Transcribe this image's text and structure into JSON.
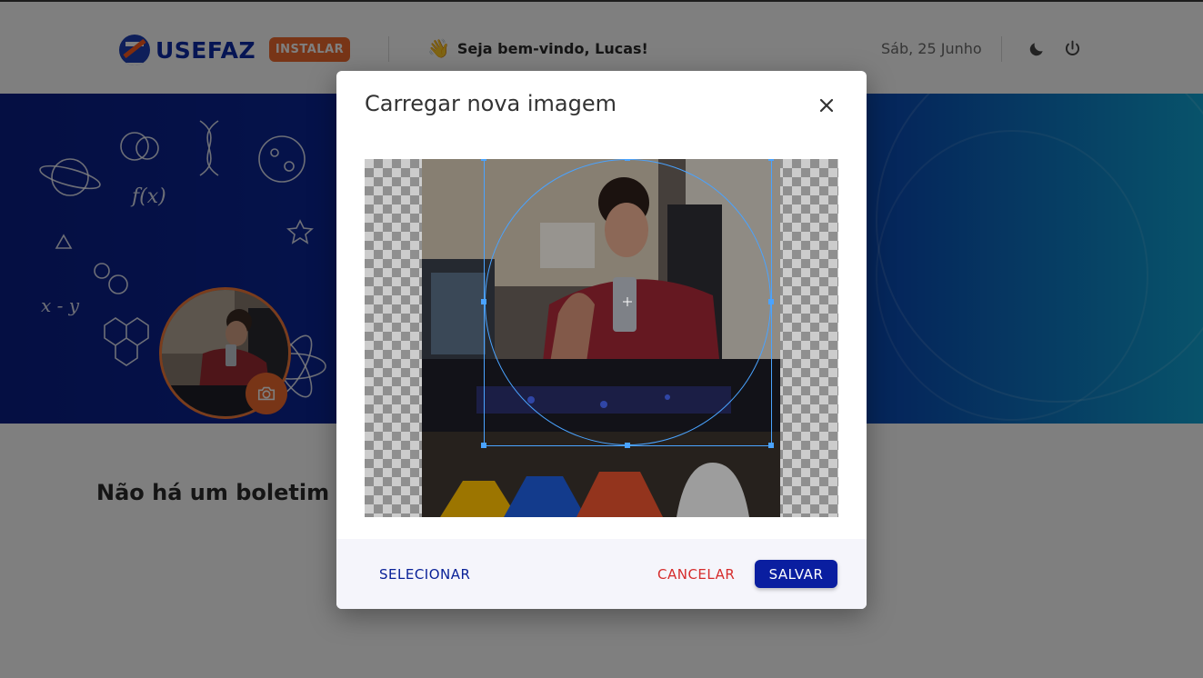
{
  "header": {
    "brand": "USEFAZ",
    "install_label": "INSTALAR",
    "welcome_text": "Seja bem-vindo, Lucas!",
    "welcome_emoji": "👋",
    "date": "Sáb, 25 Junho",
    "icons": [
      "moon-icon",
      "power-icon"
    ]
  },
  "banner": {
    "avatar_icon": "camera-icon"
  },
  "main": {
    "empty_message": "Não há um boletim reg"
  },
  "modal": {
    "title": "Carregar nova imagem",
    "close_icon": "close-icon",
    "footer": {
      "select_label": "SELECIONAR",
      "cancel_label": "CANCELAR",
      "save_label": "SALVAR"
    }
  },
  "colors": {
    "brand_blue": "#0c2aa8",
    "accent_orange": "#f06a2e",
    "save_button": "#0a1ea0",
    "cancel_text": "#d62c2c",
    "crop_outline": "#4aa3ff"
  }
}
